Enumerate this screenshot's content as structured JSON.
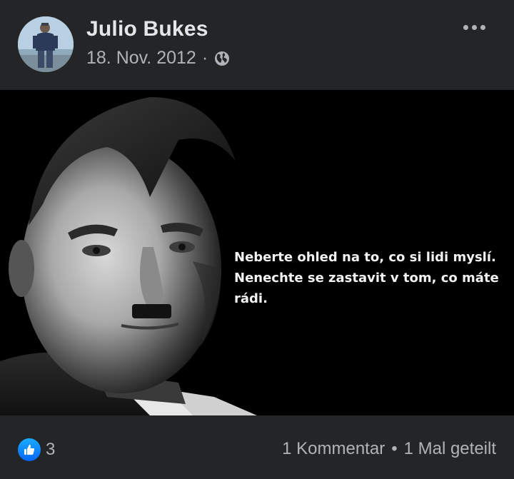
{
  "post": {
    "author": "Julio Bukes",
    "date": "18. Nov. 2012",
    "separator": "·",
    "privacy_icon": "globe-icon",
    "more_icon": "more-options-icon"
  },
  "image": {
    "caption": "Neberte ohled na to, co si lidi myslí.\nNenechte se zastavit v tom, co máte\nrádi."
  },
  "footer": {
    "reaction_icon": "like-icon",
    "reaction_count": "3",
    "comments": "1 Kommentar",
    "bullet": "•",
    "shares": "1 Mal geteilt"
  },
  "colors": {
    "background": "#242526",
    "primary_text": "#e4e6eb",
    "secondary_text": "#b0b3b8",
    "like_blue": "#0866ff"
  }
}
